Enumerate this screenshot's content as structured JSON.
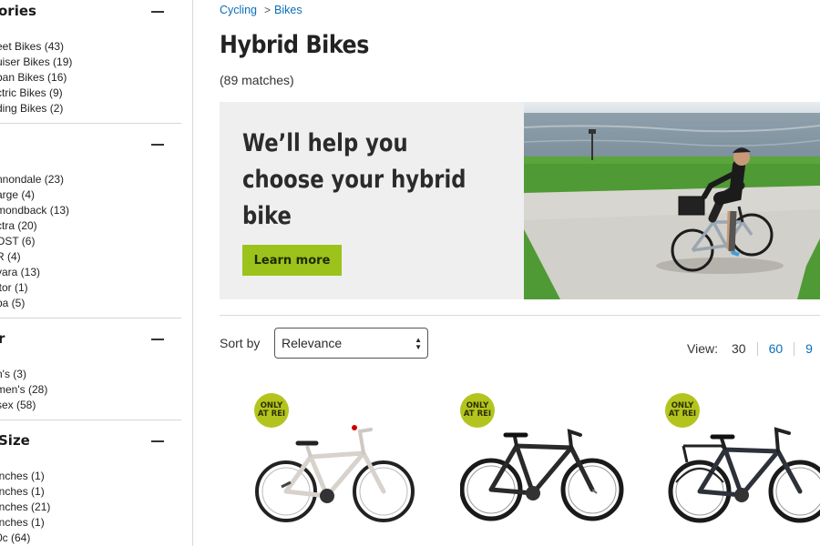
{
  "sidebar": {
    "facets": [
      {
        "title": "ories",
        "items": [
          "eet Bikes (43)",
          "uiser Bikes (19)",
          "ban Bikes (16)",
          "ctric Bikes (9)",
          "ding Bikes (2)"
        ]
      },
      {
        "title": "",
        "items": [
          "nnondale (23)",
          "arge (4)",
          "mondback (13)",
          "ctra (20)",
          "OST (6)",
          "R (4)",
          "vara (13)",
          "itor (1)",
          "ba (5)"
        ]
      },
      {
        "title": "r",
        "items": [
          "n's (3)",
          "men's (28)",
          "sex (58)"
        ]
      },
      {
        "title": "Size",
        "items": [
          "inches (1)",
          "inches (1)",
          "inches (21)",
          "inches (1)",
          "0c (64)"
        ]
      }
    ]
  },
  "breadcrumb": {
    "items": [
      "Cycling",
      "Bikes"
    ],
    "separator": ">"
  },
  "page": {
    "title": "Hybrid Bikes",
    "match_count": "(89 matches)"
  },
  "promo": {
    "headline": "We’ll help you choose your hybrid bike",
    "button_label": "Learn more"
  },
  "sort": {
    "label": "Sort by",
    "selected": "Relevance"
  },
  "view": {
    "label": "View:",
    "options": [
      "30",
      "60",
      "9"
    ]
  },
  "products": [
    {
      "badge_line1": "ONLY",
      "badge_line2": "AT REI",
      "bike_color": "silver"
    },
    {
      "badge_line1": "ONLY",
      "badge_line2": "AT REI",
      "bike_color": "black"
    },
    {
      "badge_line1": "ONLY",
      "badge_line2": "AT REI",
      "bike_color": "black"
    }
  ],
  "colors": {
    "link": "#0b6fb8",
    "accent_green": "#9cc31b",
    "badge_green": "#b3c41f",
    "promo_bg": "#efefef"
  }
}
